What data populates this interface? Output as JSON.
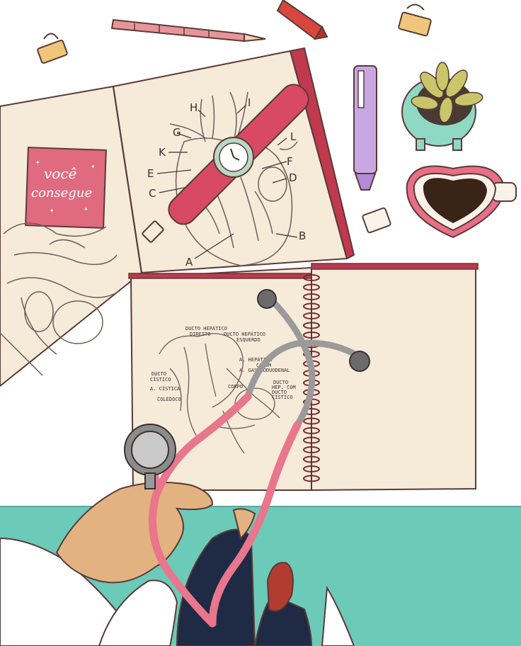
{
  "sticky_note": {
    "line1": "você",
    "line2": "consegue"
  },
  "heart_labels": [
    "A",
    "B",
    "C",
    "D",
    "E",
    "F",
    "G",
    "H",
    "I",
    "K",
    "L"
  ],
  "liver_labels": {
    "ducto_hepatico_direito_1": "DUCTO HEPÁTICO",
    "ducto_hepatico_direito_2": "DIREITO",
    "ducto_hepatico_esquerdo_1": "DUCTO HEPÁTICO",
    "ducto_hepatico_esquerdo_2": "ESQUERDO",
    "a_hepatica_1": "A. HEPÁTICA",
    "a_hepatica_2": "COMUM",
    "gastroduodenal": "A. GASTRODUODENAL",
    "ducto_cistico_1": "DUCTO",
    "ducto_cistico_2": "CÍSTICO",
    "a_cistica": "A. CÍSTICA",
    "coledoco": "COLÉDOCO",
    "ducto_hep_com_1": "DUCTO",
    "ducto_hep_com_2": "HEP. COM",
    "ducto_hep_com_3": "DUCTO",
    "ducto_hep_com_4": "CÍSTICO",
    "corpo": "CORPO"
  },
  "colors": {
    "paper": "#f6ead9",
    "cover_red": "#c0394f",
    "pink": "#e8768c",
    "teal": "#6ccab9",
    "stethoscope_gray": "#9a9a9a",
    "skin": "#e2b281",
    "navy": "#1f2a44",
    "coffee": "#3a2418",
    "lavender": "#c9a7e3"
  },
  "icons": [
    "pencil-icon",
    "pen-icon",
    "binder-clip-icon",
    "highlighter-icon",
    "eraser-icon",
    "succulent-icon",
    "coffee-mug-icon",
    "wristwatch-icon",
    "stethoscope-icon",
    "spiral-notebook-icon",
    "open-book-icon"
  ]
}
